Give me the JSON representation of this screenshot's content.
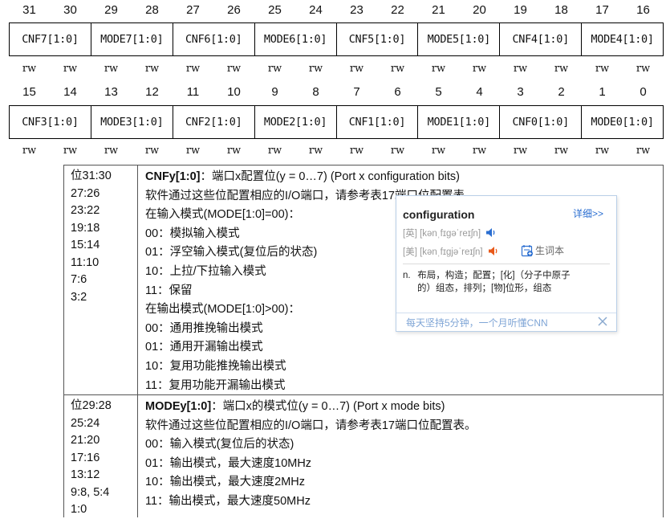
{
  "register": {
    "bits_high": [
      "31",
      "30",
      "29",
      "28",
      "27",
      "26",
      "25",
      "24",
      "23",
      "22",
      "21",
      "20",
      "19",
      "18",
      "17",
      "16"
    ],
    "fields_high": [
      "CNF7[1:0]",
      "MODE7[1:0]",
      "CNF6[1:0]",
      "MODE6[1:0]",
      "CNF5[1:0]",
      "MODE5[1:0]",
      "CNF4[1:0]",
      "MODE4[1:0]"
    ],
    "access_high": [
      "rw",
      "rw",
      "rw",
      "rw",
      "rw",
      "rw",
      "rw",
      "rw",
      "rw",
      "rw",
      "rw",
      "rw",
      "rw",
      "rw",
      "rw",
      "rw"
    ],
    "bits_low": [
      "15",
      "14",
      "13",
      "12",
      "11",
      "10",
      "9",
      "8",
      "7",
      "6",
      "5",
      "4",
      "3",
      "2",
      "1",
      "0"
    ],
    "fields_low": [
      "CNF3[1:0]",
      "MODE3[1:0]",
      "CNF2[1:0]",
      "MODE2[1:0]",
      "CNF1[1:0]",
      "MODE1[1:0]",
      "CNF0[1:0]",
      "MODE0[1:0]"
    ],
    "access_low": [
      "rw",
      "rw",
      "rw",
      "rw",
      "rw",
      "rw",
      "rw",
      "rw",
      "rw",
      "rw",
      "rw",
      "rw",
      "rw",
      "rw",
      "rw",
      "rw"
    ]
  },
  "description": {
    "cnf": {
      "bits": [
        "位31:30",
        "27:26",
        "23:22",
        "19:18",
        "15:14",
        "11:10",
        "7:6",
        "3:2"
      ],
      "title_bold": "CNFy[1:0]",
      "title_rest": "：端口x配置位(y = 0…7) (Port x configuration bits)",
      "lines": [
        "软件通过这些位配置相应的I/O端口，请参考表17端口位配置表。",
        "在输入模式(MODE[1:0]=00)：",
        "00：模拟输入模式",
        "01：浮空输入模式(复位后的状态)",
        "10：上拉/下拉输入模式",
        "11：保留",
        "在输出模式(MODE[1:0]>00)：",
        "00：通用推挽输出模式",
        "01：通用开漏输出模式",
        "10：复用功能推挽输出模式",
        "11：复用功能开漏输出模式"
      ]
    },
    "mode": {
      "bits": [
        "位29:28",
        "25:24",
        "21:20",
        "17:16",
        "13:12",
        "9:8, 5:4",
        "1:0"
      ],
      "title_bold": "MODEy[1:0]",
      "title_rest": "：端口x的模式位(y = 0…7) (Port x mode bits)",
      "lines": [
        "软件通过这些位配置相应的I/O端口，请参考表17端口位配置表。",
        "00：输入模式(复位后的状态)",
        "01：输出模式，最大速度10MHz",
        "10：输出模式，最大速度2MHz",
        "11：输出模式，最大速度50MHz"
      ]
    }
  },
  "popup": {
    "word": "configuration",
    "more_link": "详细>>",
    "pron_uk": "[英] [kənˌfɪɡəˈreɪʃn]",
    "pron_us": "[美] [kənˌfɪɡjəˈreɪʃn]",
    "add_word": "生词本",
    "def_pos": "n.",
    "def_line1": "布局，构造；配置；[化]（分子中原子",
    "def_line2": "的）组态，排列；[物]位形，组态",
    "footer_text": "每天坚持5分钟，一个月听懂CNN",
    "colors": {
      "accent": "#2a6ed1",
      "speaker_uk": "#2a6ed1",
      "speaker_us": "#e8591a",
      "footer_text": "#7fa5d6"
    }
  }
}
